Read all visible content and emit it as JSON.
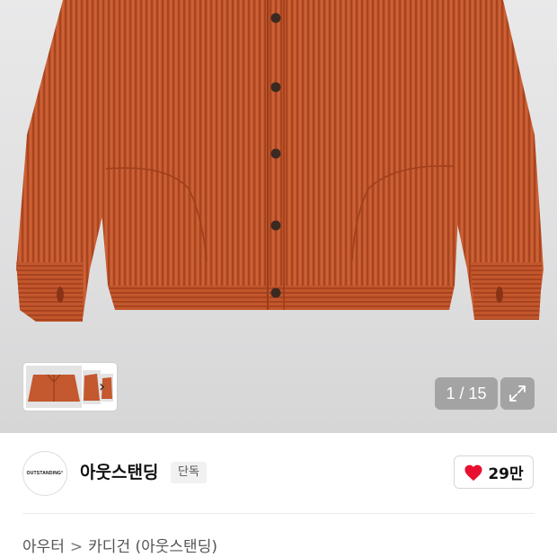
{
  "gallery": {
    "page_counter": "1 / 15",
    "thumbnail_strip_icon": "chevron-right-icon",
    "expand_icon": "expand-arrows-icon"
  },
  "brand": {
    "logo_text": "OUTSTANDING°",
    "name": "아웃스탠딩",
    "badge": "단독"
  },
  "like": {
    "icon": "heart-icon",
    "count": "29만",
    "color": "#e8102e"
  },
  "breadcrumb": {
    "items": [
      "아우터",
      "카디건 (아웃스탠딩)"
    ],
    "separator": ">"
  },
  "colors": {
    "product": "#c4582e",
    "background": "#e3e3e4"
  }
}
